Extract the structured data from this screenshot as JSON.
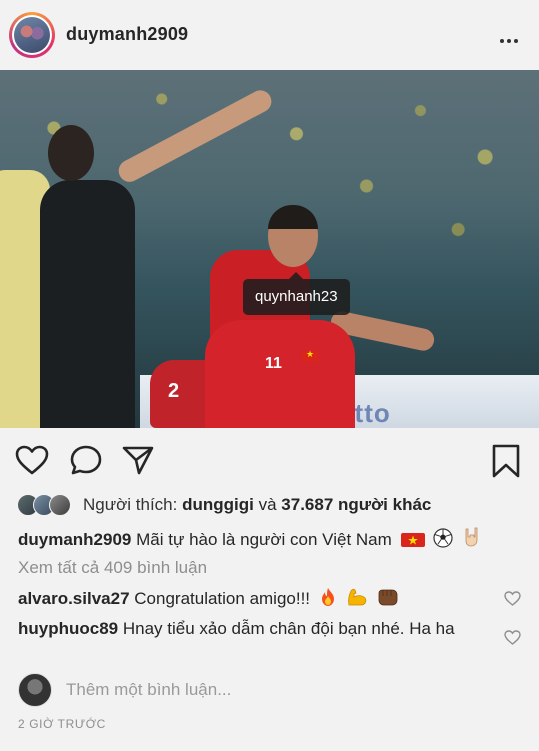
{
  "post": {
    "username": "duymanh2909",
    "tagged_user": "quynhanh23",
    "board_text": "Motto",
    "shirt_numbers": [
      "11",
      "11",
      "2"
    ]
  },
  "actions": {
    "like_icon": "heart-icon",
    "comment_icon": "comment-icon",
    "share_icon": "send-icon",
    "save_icon": "bookmark-icon"
  },
  "likes": {
    "prefix": "Người thích:",
    "first_liker": "dunggigi",
    "connector": "và",
    "others": "37.687 người khác"
  },
  "caption": {
    "username": "duymanh2909",
    "text": "Mãi tự hào là người con Việt Nam",
    "emojis": [
      "vietnam-flag",
      "soccer-ball",
      "rock-hand"
    ]
  },
  "view_all_comments": "Xem tất cả 409 bình luận",
  "comments": [
    {
      "username": "alvaro.silva27",
      "text": "Congratulation amigo!!!",
      "emojis": [
        "fire",
        "flexed-biceps",
        "fist-bump"
      ]
    },
    {
      "username": "huyphuoc89",
      "text": "Hnay tiểu xảo dẫm chân đội bạn nhé. Ha ha"
    }
  ],
  "add_comment_placeholder": "Thêm một bình luận...",
  "timestamp": "2 GIỜ TRƯỚC"
}
